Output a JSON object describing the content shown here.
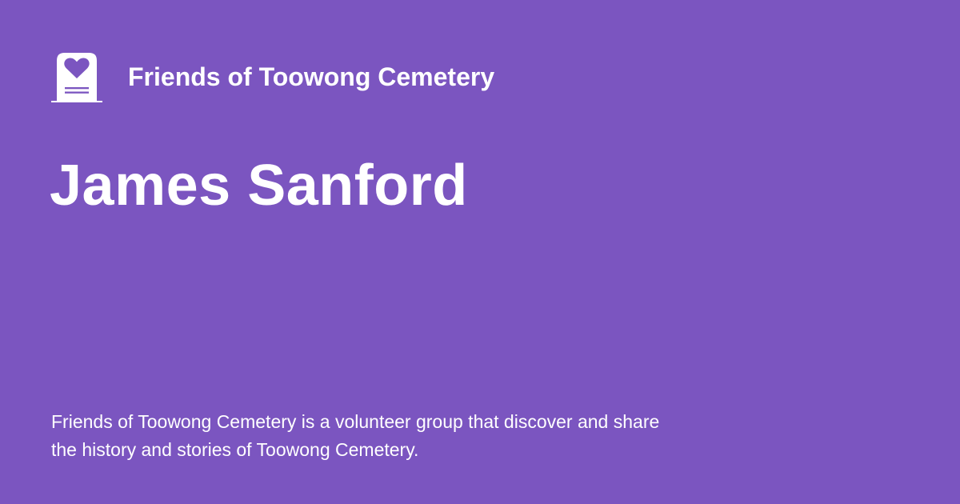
{
  "brand": {
    "logo_icon": "heart-headstone-icon",
    "name": "Friends of Toowong Cemetery"
  },
  "page": {
    "title": "James Sanford",
    "description": "Friends of Toowong Cemetery is a volunteer group that discover and share the history and stories of Toowong Cemetery."
  },
  "colors": {
    "background": "#7b55c0",
    "foreground": "#ffffff"
  }
}
